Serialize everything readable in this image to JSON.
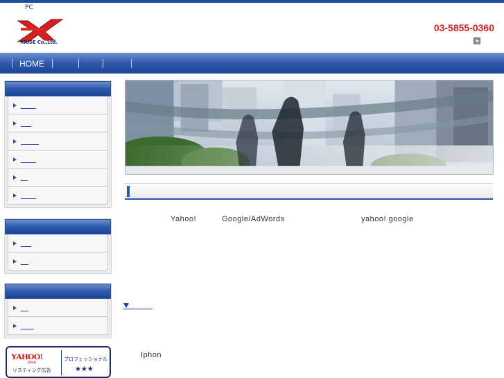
{
  "header": {
    "pc_label": "PC",
    "logo_text": "RAISE Co.,Ltd.",
    "phone": "03-5855-0360"
  },
  "nav": {
    "items": [
      {
        "label": "HOME"
      },
      {
        "label": ""
      },
      {
        "label": ""
      },
      {
        "label": ""
      },
      {
        "label": ""
      }
    ]
  },
  "sidebar": {
    "groups": [
      {
        "item_count": 6
      },
      {
        "item_count": 2
      },
      {
        "item_count": 2
      }
    ]
  },
  "banner": {
    "brand": "YAHOO!",
    "brand_sub": "JAPAN",
    "left_caption": "リスティング広告",
    "right_caption": "プロフェッショナル",
    "rating": "★★★"
  },
  "main": {
    "text_1": "Yahoo!",
    "text_2": "Google/AdWords",
    "text_3": "yahoo! google",
    "text_4": "Iphon"
  },
  "colors": {
    "accent_blue": "#2a56a8",
    "phone_red": "#d21e1e"
  }
}
